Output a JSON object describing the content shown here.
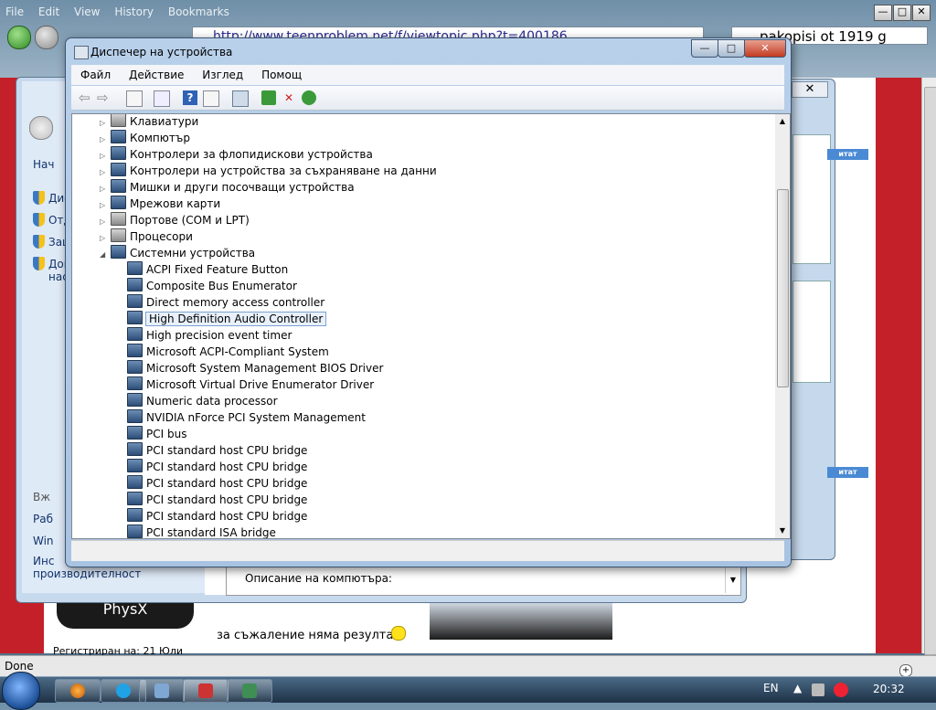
{
  "browser": {
    "menu": [
      "File",
      "Edit",
      "View",
      "History",
      "Bookmarks"
    ],
    "url": "http://www.teenproblem.net/f/viewtopic.php?t=400186",
    "search": "pakopisi ot 1919 g",
    "status": "Done",
    "page": {
      "caption_text": "за съжаление няма резултат",
      "registered_text": "Регистриран на: 21 Юли",
      "physx_label": "PhysX",
      "green_btn_label": "итат"
    }
  },
  "system_properties": {
    "sidebar": {
      "start_text": "Нач",
      "links": [
        "Дис",
        "Отд",
        "Защ",
        "Доп"
      ],
      "links_second_line": "нас",
      "see_also": "Вж",
      "bottom_items": [
        "Раб",
        "Win",
        "Инс"
      ],
      "bottom_second_line": "производителност"
    },
    "description_label": "Описание на компютъра:"
  },
  "device_manager": {
    "title": "Диспечер на устройства",
    "window_controls": {
      "minimize": "—",
      "maximize": "□",
      "close": "✕"
    },
    "menu": [
      "Файл",
      "Действие",
      "Изглед",
      "Помощ"
    ],
    "toolbar_icons": [
      "back-icon",
      "forward-icon",
      "properties-view-icon",
      "show-hide-tree-icon",
      "help-icon",
      "action-pane-icon",
      "scan-hardware-icon",
      "update-driver-icon",
      "uninstall-icon",
      "enable-device-icon"
    ],
    "categories": [
      {
        "label": "Клавиатури",
        "expanded": false,
        "icon": "keyboard-icon"
      },
      {
        "label": "Компютър",
        "expanded": false,
        "icon": "computer-icon"
      },
      {
        "label": "Контролери за флопидискови устройства",
        "expanded": false,
        "icon": "floppy-controller-icon"
      },
      {
        "label": "Контролери на устройства за съхраняване на данни",
        "expanded": false,
        "icon": "storage-controller-icon"
      },
      {
        "label": "Мишки и други посочващи устройства",
        "expanded": false,
        "icon": "mouse-icon"
      },
      {
        "label": "Мрежови карти",
        "expanded": false,
        "icon": "network-adapter-icon"
      },
      {
        "label": "Портове (COM и LPT)",
        "expanded": false,
        "icon": "port-icon"
      },
      {
        "label": "Процесори",
        "expanded": false,
        "icon": "processor-icon"
      },
      {
        "label": "Системни устройства",
        "expanded": true,
        "icon": "system-devices-icon"
      }
    ],
    "system_devices": [
      "ACPI Fixed Feature Button",
      "Composite Bus Enumerator",
      "Direct memory access controller",
      "High Definition Audio Controller",
      "High precision event timer",
      "Microsoft ACPI-Compliant System",
      "Microsoft System Management BIOS Driver",
      "Microsoft Virtual Drive Enumerator Driver",
      "Numeric data processor",
      "NVIDIA nForce PCI System Management",
      "PCI bus",
      "PCI standard host CPU bridge",
      "PCI standard host CPU bridge",
      "PCI standard host CPU bridge",
      "PCI standard host CPU bridge",
      "PCI standard host CPU bridge",
      "PCI standard ISA bridge"
    ],
    "selected_device": "High Definition Audio Controller"
  },
  "taskbar": {
    "language": "EN",
    "clock": "20:32",
    "buttons": [
      "firefox-icon",
      "skype-icon",
      "system-properties-icon",
      "task-manager-icon",
      "device-manager-icon"
    ]
  }
}
